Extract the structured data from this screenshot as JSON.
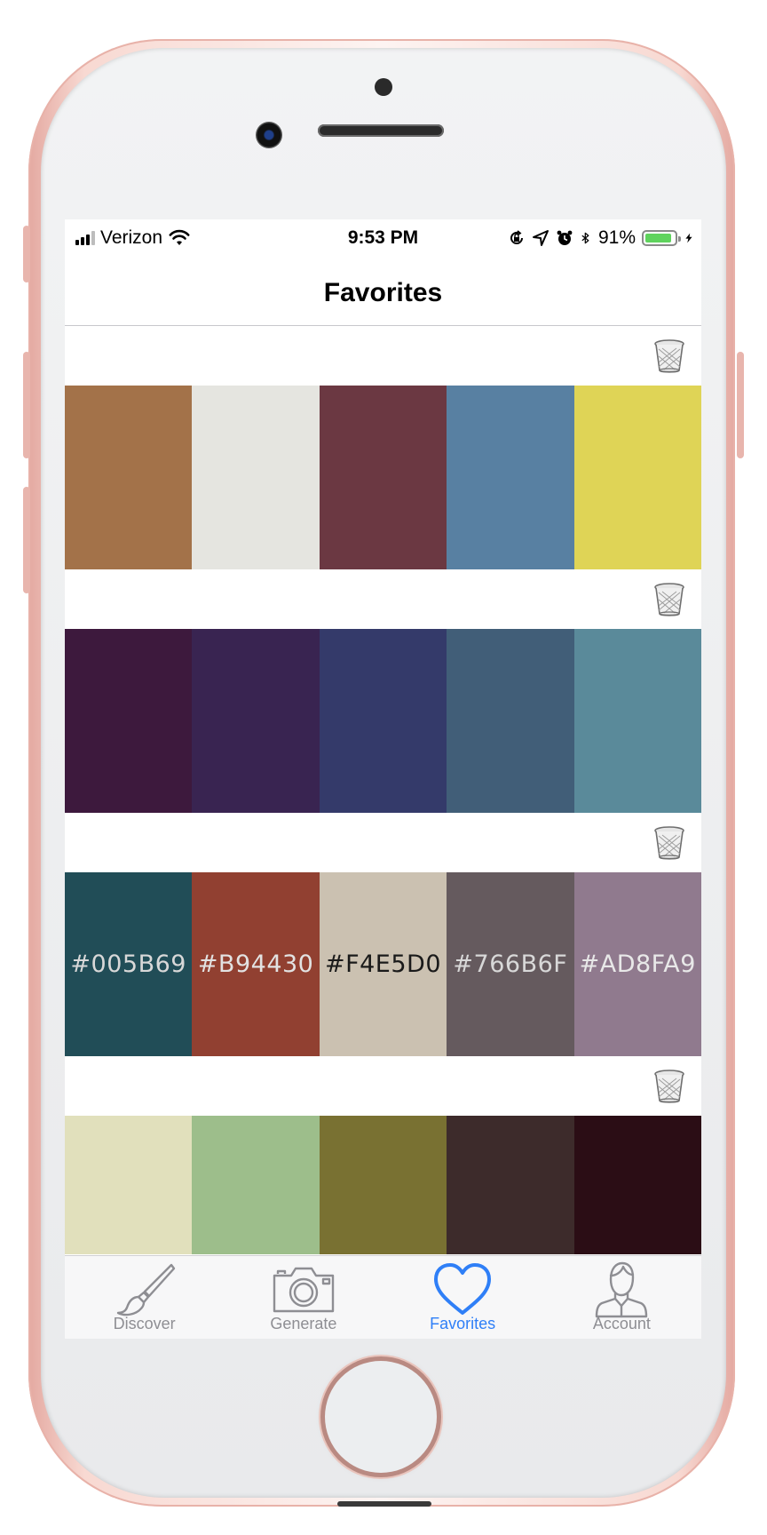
{
  "status_bar": {
    "carrier": "Verizon",
    "time": "9:53 PM",
    "battery_percent": "91%",
    "battery_level": 0.91,
    "battery_color": "#5fd35d"
  },
  "nav": {
    "title": "Favorites"
  },
  "palettes": [
    {
      "show_labels": false,
      "colors": [
        {
          "hex": "#A37249",
          "label": ""
        },
        {
          "hex": "#E5E5E0",
          "label": ""
        },
        {
          "hex": "#6B3842",
          "label": ""
        },
        {
          "hex": "#5880A2",
          "label": ""
        },
        {
          "hex": "#DFD456",
          "label": ""
        }
      ]
    },
    {
      "show_labels": false,
      "colors": [
        {
          "hex": "#3D193D",
          "label": ""
        },
        {
          "hex": "#392451",
          "label": ""
        },
        {
          "hex": "#343A6A",
          "label": ""
        },
        {
          "hex": "#415E78",
          "label": ""
        },
        {
          "hex": "#5A8A9A",
          "label": ""
        }
      ]
    },
    {
      "show_labels": true,
      "colors": [
        {
          "hex": "#214D57",
          "label": "#005B69",
          "text_color": "#d8d8d8"
        },
        {
          "hex": "#914031",
          "label": "#B94430",
          "text_color": "#e2e2e2"
        },
        {
          "hex": "#CBC1B1",
          "label": "#F4E5D0",
          "text_color": "#1a1a1a"
        },
        {
          "hex": "#655A5E",
          "label": "#766B6F",
          "text_color": "#d8d8d8"
        },
        {
          "hex": "#907A8E",
          "label": "#AD8FA9",
          "text_color": "#e8e8e8"
        }
      ]
    },
    {
      "show_labels": false,
      "colors": [
        {
          "hex": "#E1E0BC",
          "label": ""
        },
        {
          "hex": "#9DBE8B",
          "label": ""
        },
        {
          "hex": "#797132",
          "label": ""
        },
        {
          "hex": "#3D2B2B",
          "label": ""
        },
        {
          "hex": "#2B0D15",
          "label": ""
        }
      ]
    }
  ],
  "tabs": [
    {
      "label": "Discover",
      "icon": "paintbrush-icon",
      "active": false
    },
    {
      "label": "Generate",
      "icon": "camera-icon",
      "active": false
    },
    {
      "label": "Favorites",
      "icon": "heart-icon",
      "active": true
    },
    {
      "label": "Account",
      "icon": "person-icon",
      "active": false
    }
  ],
  "colors": {
    "accent": "#2f7ff7",
    "inactive_tab": "#8e8e93",
    "phone_frame": "#e8b2a9"
  }
}
